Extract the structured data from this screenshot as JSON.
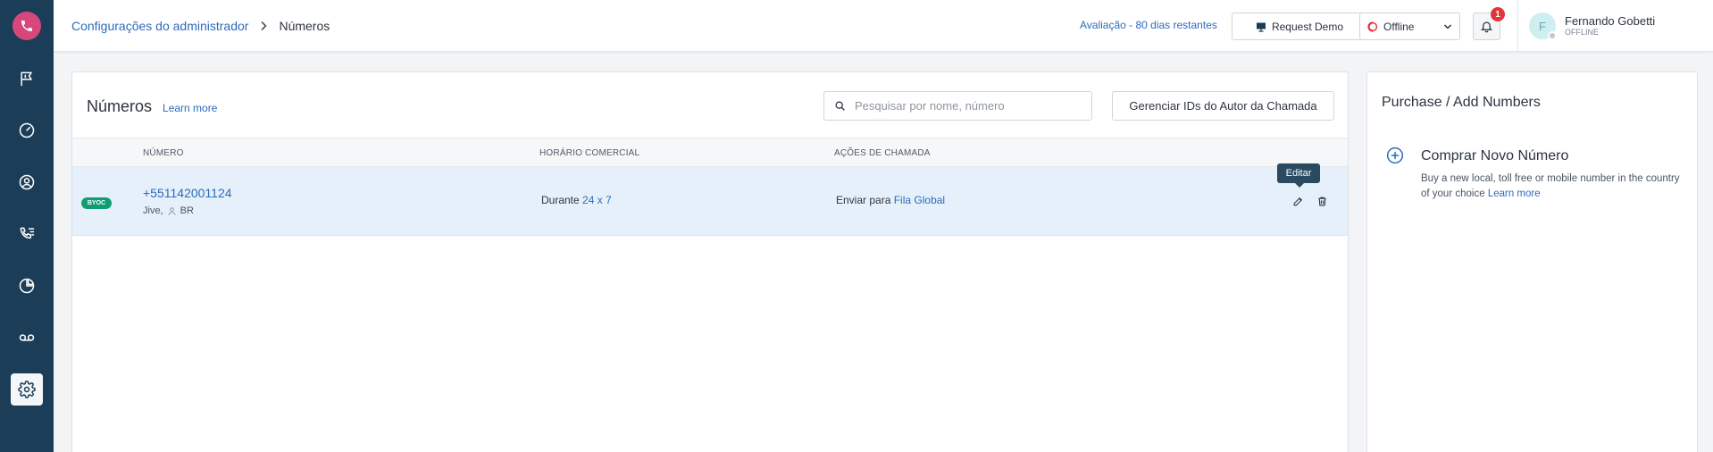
{
  "sidebar": {
    "logo_icon": "phone-icon",
    "items": [
      {
        "name": "flag-icon"
      },
      {
        "name": "dashboard-gauge-icon"
      },
      {
        "name": "contacts-icon"
      },
      {
        "name": "call-log-icon"
      },
      {
        "name": "analytics-icon"
      },
      {
        "name": "voicemail-icon"
      },
      {
        "name": "settings-gear-icon",
        "active": true
      }
    ],
    "bg_color": "#1b3d57",
    "logo_color": "#d6487b"
  },
  "header": {
    "breadcrumb": {
      "parent": "Configurações do administrador",
      "current": "Números"
    },
    "trial_text": "Avaliação - 80 dias restantes",
    "request_demo_label": "Request Demo",
    "status_label": "Offline",
    "notification_count": "1",
    "user": {
      "initial": "F",
      "name": "Fernando Gobetti",
      "presence": "OFFLINE"
    }
  },
  "main": {
    "title": "Números",
    "learn_more": "Learn more",
    "search_placeholder": "Pesquisar por nome, número",
    "manage_caller_ids_label": "Gerenciar IDs do Autor da Chamada",
    "columns": [
      "NÚMERO",
      "HORÁRIO COMERCIAL",
      "AÇÕES DE CHAMADA"
    ],
    "rows": [
      {
        "badge": "BYOC",
        "number": "+551142001124",
        "provider": "Jive,",
        "country": "BR",
        "hours_prefix": "Durante",
        "hours_value": "24 x 7",
        "action_prefix": "Enviar para",
        "action_target": "Fila Global"
      }
    ],
    "tooltip": "Editar"
  },
  "purchase": {
    "title": "Purchase / Add Numbers",
    "buy_title": "Comprar Novo Número",
    "buy_desc": "Buy a new local, toll free or mobile number in the country of your choice",
    "learn_more": "Learn more"
  },
  "colors": {
    "accent": "#2d6bbd",
    "byoc_badge": "#0f9d74",
    "notification_badge": "#e2343a",
    "row_highlight": "#e5f0fb"
  }
}
